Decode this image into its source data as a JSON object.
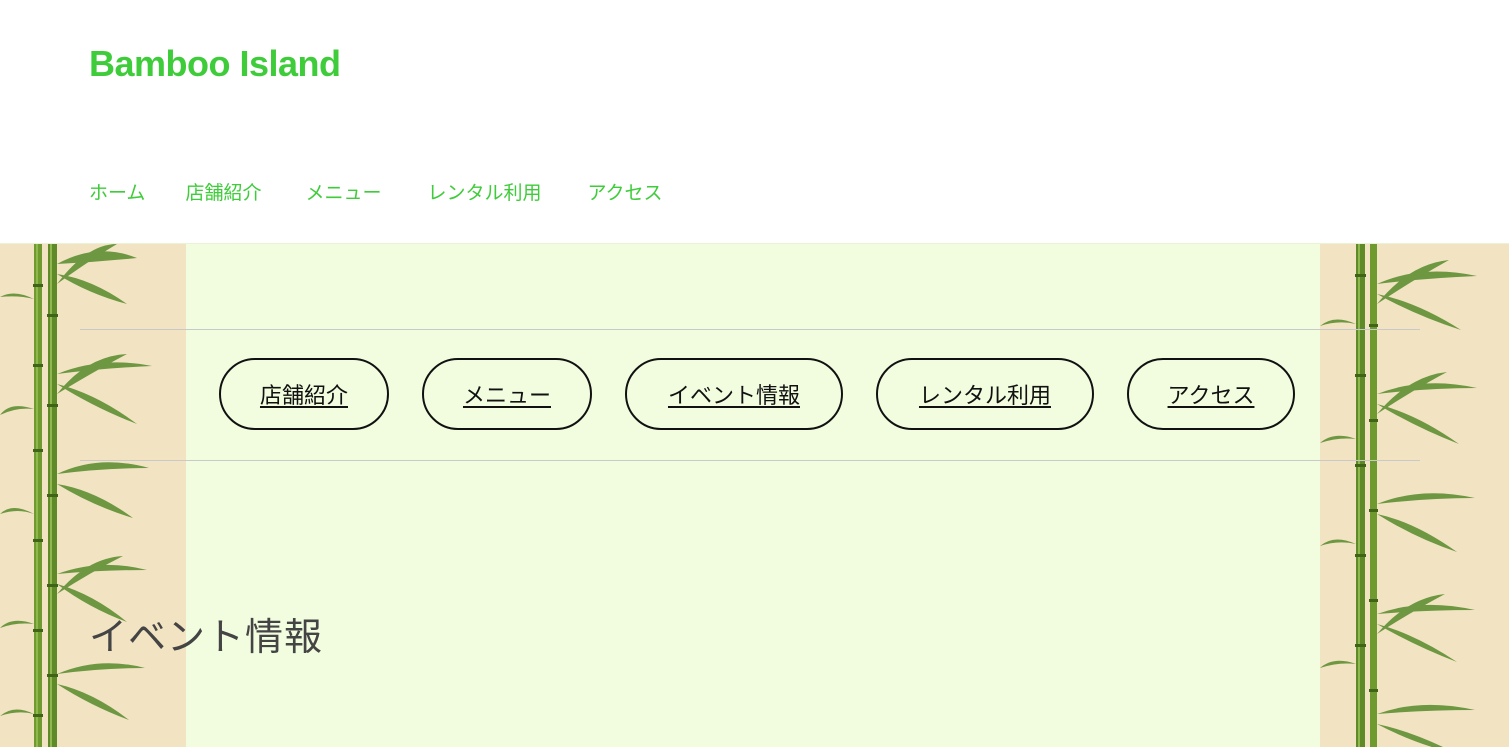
{
  "site": {
    "title": "Bamboo Island",
    "brand_color": "#3fcc3a"
  },
  "header_nav": {
    "items": [
      {
        "label": "ホーム"
      },
      {
        "label": "店舗紹介"
      },
      {
        "label": "メニュー"
      },
      {
        "label": "レンタル利用"
      },
      {
        "label": "アクセス"
      }
    ]
  },
  "content": {
    "background_color": "#f2fde0",
    "pill_nav": {
      "items": [
        {
          "label": "店舗紹介"
        },
        {
          "label": "メニュー"
        },
        {
          "label": "イベント情報"
        },
        {
          "label": "レンタル利用"
        },
        {
          "label": "アクセス"
        }
      ]
    },
    "section_title": "イベント情報",
    "decoration": "bamboo-illustration"
  }
}
